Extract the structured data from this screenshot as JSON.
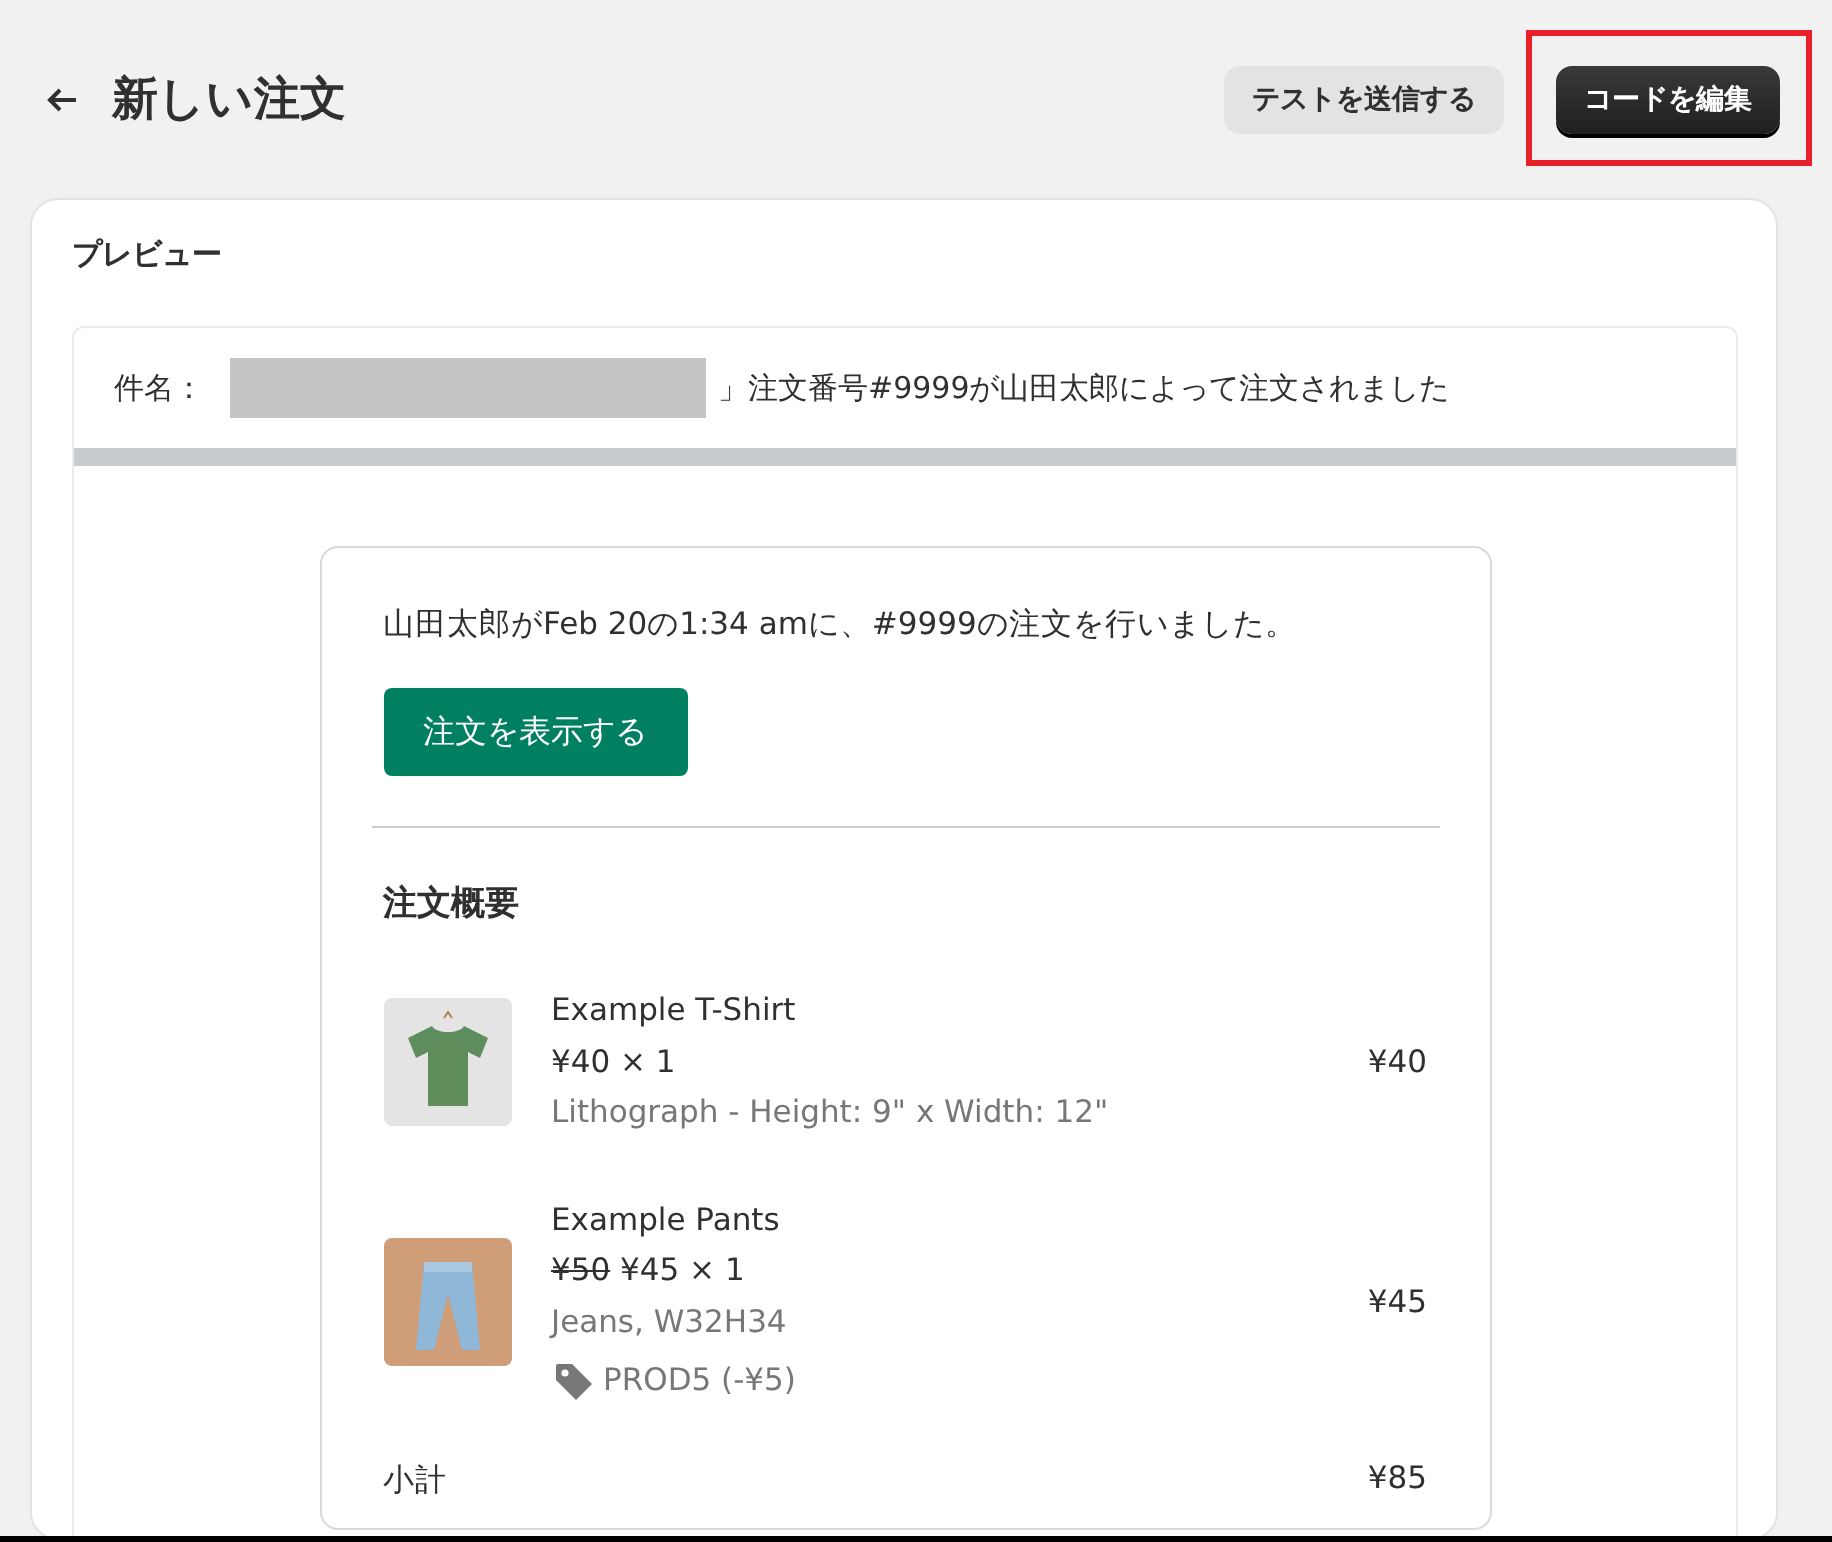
{
  "header": {
    "title": "新しい注文",
    "buttons": [
      {
        "label": "テストを送信する",
        "kind": "secondary",
        "highlighted": false
      },
      {
        "label": "コードを編集",
        "kind": "primary",
        "highlighted": true
      }
    ]
  },
  "preview": {
    "heading": "プレビュー",
    "subject": {
      "label": "件名：",
      "redacted": true,
      "text": "」注文番号#9999が山田太郎によって注文されました"
    },
    "email": {
      "message": "山田太郎がFeb 20の1:34 amに、#9999の注文を行いました。",
      "button": "注文を表示する",
      "summary_heading": "注文概要",
      "items": [
        {
          "kind": "tshirt",
          "name": "Example T-Shirt",
          "price_line": "¥40 × 1",
          "variant": "Lithograph - Height: 9\" x Width: 12\"",
          "total": "¥40"
        },
        {
          "kind": "pants",
          "name": "Example Pants",
          "original_price": "¥50",
          "price_line": "¥45 × 1",
          "variant": "Jeans, W32H34",
          "discount": "PROD5 (-¥5)",
          "total": "¥45"
        }
      ],
      "subtotal": {
        "label": "小計",
        "value": "¥85"
      }
    }
  }
}
